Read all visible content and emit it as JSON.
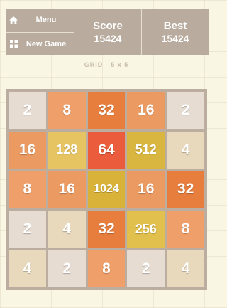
{
  "menu": {
    "menu_label": "Menu",
    "new_game_label": "New Game"
  },
  "score": {
    "title": "Score",
    "value": "15424"
  },
  "best": {
    "title": "Best",
    "value": "15424"
  },
  "grid_label": "GRID - 5 x 5",
  "colors": {
    "2": "#e6dcd2",
    "4": "#e8d9bc",
    "8": "#efa06a",
    "16": "#eb9b62",
    "32": "#e77e3e",
    "64": "#ea5c3c",
    "128": "#e6c462",
    "256": "#e2c04d",
    "512": "#d9b63f",
    "1024": "#d9b23a"
  },
  "board": [
    [
      "2",
      "8",
      "32",
      "16",
      "2"
    ],
    [
      "16",
      "128",
      "64",
      "512",
      "4"
    ],
    [
      "8",
      "16",
      "1024",
      "16",
      "32"
    ],
    [
      "2",
      "4",
      "32",
      "256",
      "8"
    ],
    [
      "4",
      "2",
      "8",
      "2",
      "4"
    ]
  ]
}
